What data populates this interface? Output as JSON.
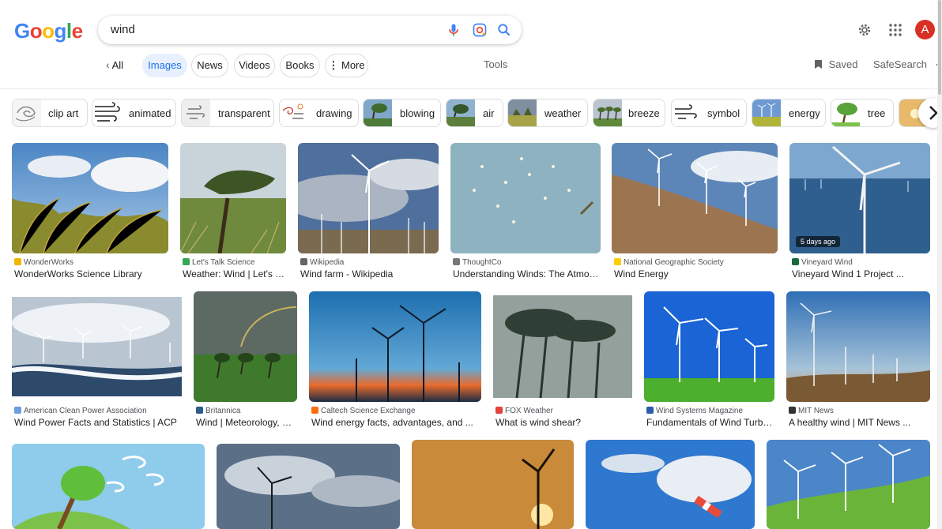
{
  "header": {
    "logo_letters": [
      "G",
      "o",
      "o",
      "g",
      "l",
      "e"
    ],
    "search_query": "wind",
    "icons": [
      "mic-icon",
      "lens-icon",
      "search-icon",
      "gear-icon",
      "apps-grid-icon"
    ],
    "avatar_initial": "A"
  },
  "tabs": {
    "all_label": "All",
    "items": [
      {
        "label": "Images",
        "active": true
      },
      {
        "label": "News",
        "active": false
      },
      {
        "label": "Videos",
        "active": false
      },
      {
        "label": "Books",
        "active": false
      },
      {
        "label": "More",
        "active": false
      }
    ],
    "tools_label": "Tools",
    "saved_label": "Saved",
    "safesearch_label": "SafeSearch"
  },
  "chips": [
    {
      "label": "clip art"
    },
    {
      "label": "animated"
    },
    {
      "label": "transparent"
    },
    {
      "label": "drawing"
    },
    {
      "label": "blowing"
    },
    {
      "label": "air"
    },
    {
      "label": "weather"
    },
    {
      "label": "breeze"
    },
    {
      "label": "symbol"
    },
    {
      "label": "energy"
    },
    {
      "label": "tree"
    }
  ],
  "results": {
    "row1": [
      {
        "source": "WonderWorks",
        "title": "WonderWorks Science Library"
      },
      {
        "source": "Let's Talk Science",
        "title": "Weather: Wind | Let's Ta..."
      },
      {
        "source": "Wikipedia",
        "title": "Wind farm - Wikipedia"
      },
      {
        "source": "ThoughtCo",
        "title": "Understanding Winds: The Atmosp..."
      },
      {
        "source": "National Geographic Society",
        "title": "Wind Energy"
      },
      {
        "source": "Vineyard Wind",
        "title": "Vineyard Wind 1 Project ...",
        "badge": "5 days ago"
      }
    ],
    "row2": [
      {
        "source": "American Clean Power Association",
        "title": "Wind Power Facts and Statistics | ACP"
      },
      {
        "source": "Britannica",
        "title": "Wind | Meteorology, Re..."
      },
      {
        "source": "Caltech Science Exchange",
        "title": "Wind energy facts, advantages, and ..."
      },
      {
        "source": "FOX Weather",
        "title": "What is wind shear?"
      },
      {
        "source": "Wind Systems Magazine",
        "title": "Fundamentals of Wind Turbin..."
      },
      {
        "source": "MIT News",
        "title": "A healthy wind | MIT News ..."
      }
    ]
  },
  "colors": {
    "accent": "#1a73e8",
    "active_tab_bg": "#e8f0fe",
    "avatar": "#d93025"
  }
}
